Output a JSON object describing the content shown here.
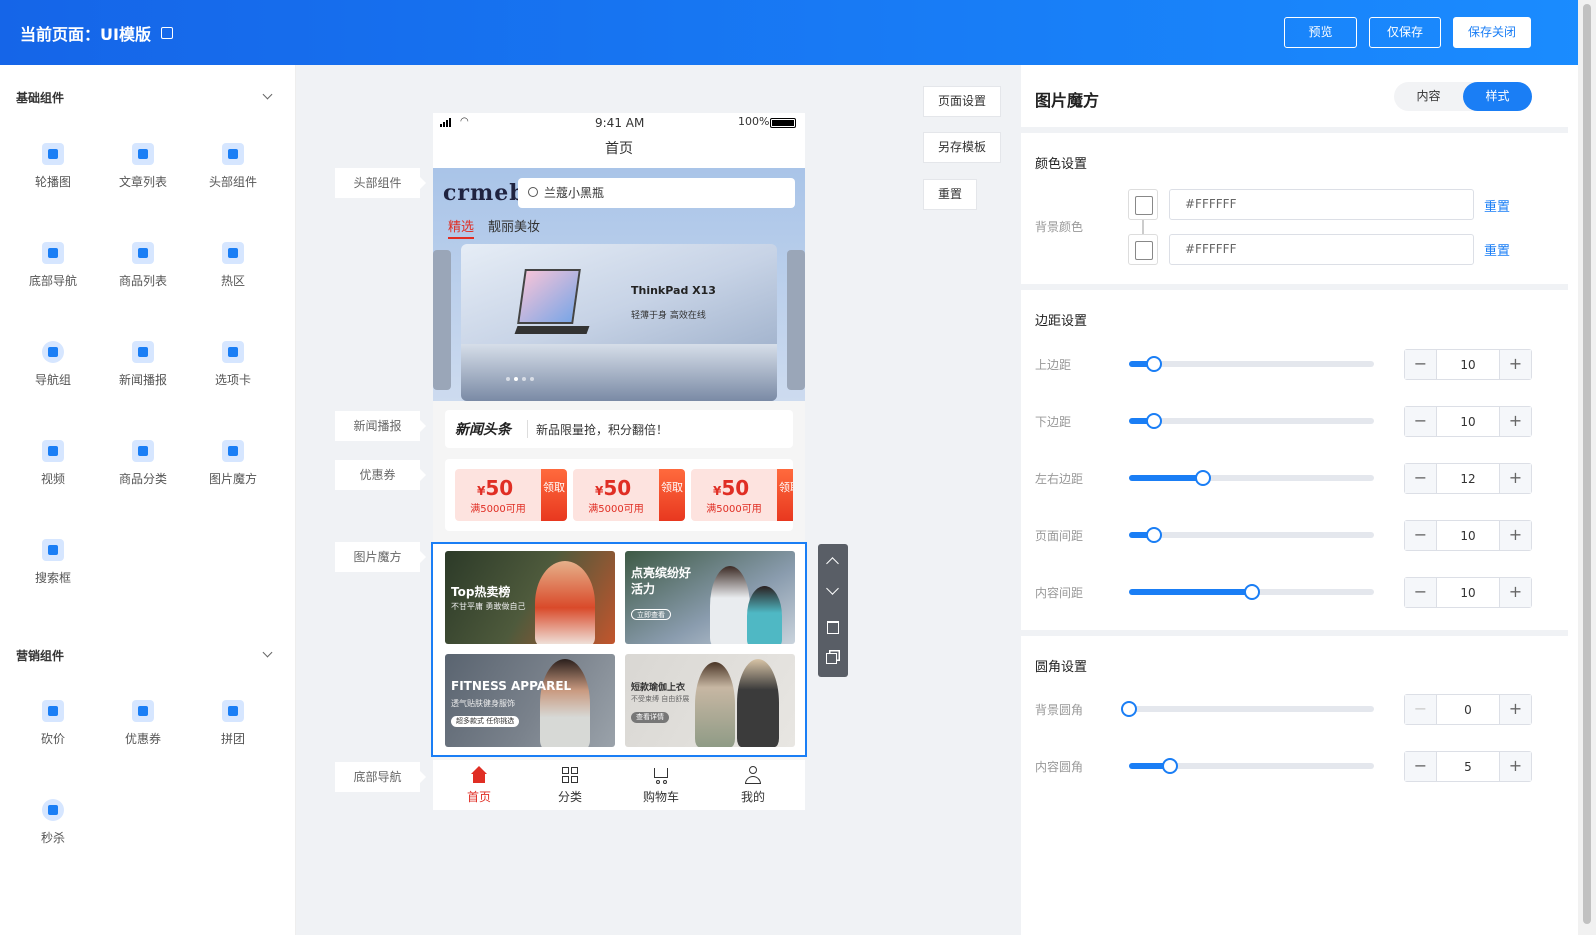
{
  "header": {
    "title_prefix": "当前页面：",
    "title_name": "UI模版",
    "btn_preview": "预览",
    "btn_save": "仅保存",
    "btn_save_close": "保存关闭"
  },
  "left": {
    "basic_title": "基础组件",
    "basic_items": [
      "轮播图",
      "文章列表",
      "头部组件",
      "底部导航",
      "商品列表",
      "热区",
      "导航组",
      "新闻播报",
      "选项卡",
      "视频",
      "商品分类",
      "图片魔方",
      "搜索框"
    ],
    "marketing_title": "营销组件",
    "marketing_items": [
      "砍价",
      "优惠券",
      "拼团",
      "秒杀"
    ]
  },
  "canvas": {
    "btn_page_settings": "页面设置",
    "btn_save_template": "另存模板",
    "btn_reset": "重置",
    "tags": [
      "头部组件",
      "新闻播报",
      "优惠券",
      "图片魔方",
      "底部导航"
    ],
    "status": {
      "time": "9:41 AM",
      "battery": "100%"
    },
    "page_title": "首页",
    "logo": "crmeb",
    "search_text": "兰蔻小黑瓶",
    "tabs": [
      "精选",
      "靓丽美妆"
    ],
    "banner": {
      "brand": "ThinkPad X13",
      "slogan": "轻薄于身 高效在线"
    },
    "news": {
      "logo": "新闻头条",
      "text": "新品限量抢，积分翻倍！"
    },
    "coupons": [
      {
        "currency": "¥",
        "amount": "50",
        "cond": "满5000可用",
        "get": "领取"
      },
      {
        "currency": "¥",
        "amount": "50",
        "cond": "满5000可用",
        "get": "领取"
      },
      {
        "currency": "¥",
        "amount": "50",
        "cond": "满5000可用",
        "get": "领取"
      }
    ],
    "magic": [
      {
        "title": "Top热卖榜",
        "sub": "不甘平庸 勇敢做自己"
      },
      {
        "title": "点亮缤纷好活力",
        "sub": "",
        "pill": "立即查看"
      },
      {
        "title": "FITNESS APPAREL",
        "sub": "透气贴肤健身服饰",
        "pill": "超多款式 任你挑选"
      },
      {
        "title": "短款瑜伽上衣",
        "sub": "不受束缚 自由舒展",
        "pill": "查看详情"
      }
    ],
    "bottom_nav": [
      "首页",
      "分类",
      "购物车",
      "我的"
    ]
  },
  "right": {
    "title": "图片魔方",
    "seg_content": "内容",
    "seg_style": "样式",
    "color_section": "颜色设置",
    "bg_color_label": "背景颜色",
    "colors": [
      "#FFFFFF",
      "#FFFFFF"
    ],
    "reset": "重置",
    "margin_section": "边距设置",
    "margins": [
      {
        "label": "上边距",
        "value": 10,
        "max": 100
      },
      {
        "label": "下边距",
        "value": 10,
        "max": 100
      },
      {
        "label": "左右边距",
        "value": 12,
        "max": 40
      },
      {
        "label": "页面间距",
        "value": 10,
        "max": 100
      },
      {
        "label": "内容间距",
        "value": 10,
        "max": 20
      }
    ],
    "radius_section": "圆角设置",
    "radius": [
      {
        "label": "背景圆角",
        "value": 0,
        "max": 30
      },
      {
        "label": "内容圆角",
        "value": 5,
        "max": 30
      }
    ]
  }
}
